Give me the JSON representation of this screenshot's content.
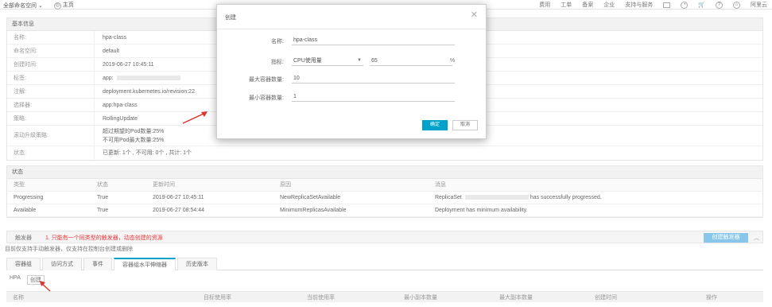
{
  "topbar": {
    "workspace_label": "全部命名空间",
    "home_label": "主页",
    "right_items": [
      "费用",
      "工单",
      "备案",
      "企业",
      "支持与服务"
    ],
    "user_label": "阿里云"
  },
  "basic_info": {
    "section_label": "基本信息",
    "rows": [
      {
        "key": "名称:",
        "value": "hpa-class"
      },
      {
        "key": "命名空间:",
        "value": "default"
      },
      {
        "key": "创建时间:",
        "value": "2019-06-27 10:45:11"
      },
      {
        "key": "标签:",
        "value": "app:"
      },
      {
        "key": "注解:",
        "value": "deployment.kubernetes.io/revision:22"
      },
      {
        "key": "选择器:",
        "value": "app:hpa-class"
      },
      {
        "key": "策略:",
        "value": "RollingUpdate"
      },
      {
        "key": "滚动升级策略:",
        "value_lines": [
          "超过期望的Pod数量:25%",
          "不可用Pod最大数量:25%"
        ]
      },
      {
        "key": "状态:",
        "value": "已更新: 1个 , 不可用: 0个 , 共计: 1个"
      }
    ]
  },
  "conditions": {
    "section_label": "状态",
    "headers": [
      "类型",
      "状态",
      "更新时间",
      "原因",
      "消息"
    ],
    "rows": [
      {
        "type": "Progressing",
        "status": "True",
        "time": "2019-06-27 10:45:11",
        "reason": "NewReplicaSetAvailable",
        "message": "ReplicaSet",
        "message_tail": "has successfully progressed."
      },
      {
        "type": "Available",
        "status": "True",
        "time": "2019-06-27 08:54:44",
        "reason": "MinimumReplicasAvailable",
        "message": "Deployment has minimum availability."
      }
    ]
  },
  "ops": {
    "label": "触发器",
    "warning": "1. 只能有一个同类型的触发器，动态创建的资源",
    "primary_button": "创建触发器",
    "subnote": "目前仅支持手动触发器，仅支持在控制台创建或删除"
  },
  "tabs": [
    "容器组",
    "访问方式",
    "事件",
    "容器组水平伸缩器",
    "历史版本"
  ],
  "active_tab_index": 3,
  "hpa": {
    "label": "HPA",
    "add_label": "创建",
    "headers": [
      "名称",
      "目标使用率",
      "当前使用率",
      "最小副本数量",
      "最大副本数量",
      "创建时间",
      "操作"
    ]
  },
  "modal": {
    "title": "创建",
    "fields": {
      "name_label": "名称:",
      "name_value": "hpa-class",
      "metric_label": "指标:",
      "metric_value": "CPU使用量",
      "metric_target_value": "65",
      "metric_suffix": "%",
      "max_label": "最大容器数量:",
      "max_value": "10",
      "min_label": "最小容器数量:",
      "min_value": "1"
    },
    "ok_label": "确定",
    "cancel_label": "取消"
  },
  "colors": {
    "primary": "#00a2ca",
    "warning": "#e4393c",
    "arrow": "#e0322f"
  }
}
